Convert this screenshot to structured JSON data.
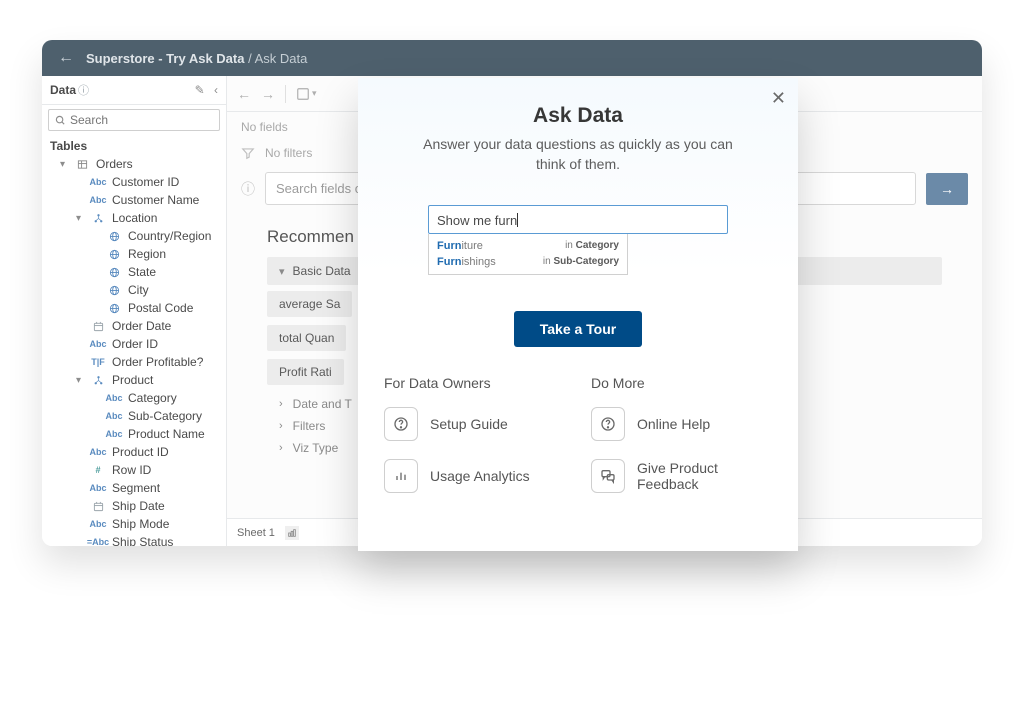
{
  "breadcrumb": {
    "main": "Superstore - Try Ask Data",
    "sub": "Ask Data"
  },
  "sidebar": {
    "title": "Data",
    "search_placeholder": "Search",
    "tables_label": "Tables",
    "tree": [
      {
        "depth": 1,
        "caret": "▾",
        "icon": "table",
        "label": "Orders"
      },
      {
        "depth": 2,
        "icon": "abc",
        "label": "Customer ID"
      },
      {
        "depth": 2,
        "icon": "abc",
        "label": "Customer Name"
      },
      {
        "depth": 2,
        "caret": "▾",
        "icon": "hier",
        "label": "Location"
      },
      {
        "depth": 3,
        "icon": "globe",
        "label": "Country/Region"
      },
      {
        "depth": 3,
        "icon": "globe",
        "label": "Region"
      },
      {
        "depth": 3,
        "icon": "globe",
        "label": "State"
      },
      {
        "depth": 3,
        "icon": "globe",
        "label": "City"
      },
      {
        "depth": 3,
        "icon": "globe",
        "label": "Postal Code"
      },
      {
        "depth": 2,
        "icon": "cal",
        "label": "Order Date"
      },
      {
        "depth": 2,
        "icon": "abc",
        "label": "Order ID"
      },
      {
        "depth": 2,
        "icon": "tf",
        "label": "Order Profitable?"
      },
      {
        "depth": 2,
        "caret": "▾",
        "icon": "hier",
        "label": "Product"
      },
      {
        "depth": 3,
        "icon": "abc",
        "label": "Category"
      },
      {
        "depth": 3,
        "icon": "abc",
        "label": "Sub-Category"
      },
      {
        "depth": 3,
        "icon": "abc",
        "label": "Product Name"
      },
      {
        "depth": 2,
        "icon": "abc",
        "label": "Product ID"
      },
      {
        "depth": 2,
        "icon": "hash",
        "label": "Row ID"
      },
      {
        "depth": 2,
        "icon": "abc",
        "label": "Segment"
      },
      {
        "depth": 2,
        "icon": "cal",
        "label": "Ship Date"
      },
      {
        "depth": 2,
        "icon": "abc",
        "label": "Ship Mode"
      },
      {
        "depth": 2,
        "icon": "calcabc",
        "label": "Ship Status"
      }
    ]
  },
  "main": {
    "no_fields": "No fields",
    "no_filters": "No filters",
    "search_placeholder": "Search fields or va",
    "recommend_title": "Recommen",
    "groups": {
      "basic": {
        "header": "Basic Data",
        "pills": [
          "average Sa",
          "total Quan",
          "Profit Rati"
        ]
      },
      "collapsed": [
        "Date and T",
        "Filters",
        "Viz Type"
      ]
    }
  },
  "footer": {
    "sheet": "Sheet 1"
  },
  "modal": {
    "title": "Ask Data",
    "subtitle": "Answer your data questions as quickly as you can think of them.",
    "input_value": "Show me furn",
    "suggestions": [
      {
        "bold": "Furn",
        "rest": "iture",
        "ctx_pre": "in",
        "ctx_val": "Category"
      },
      {
        "bold": "Furn",
        "rest": "ishings",
        "ctx_pre": "in",
        "ctx_val": "Sub-Category"
      }
    ],
    "tour_btn": "Take a Tour",
    "cols": {
      "owners": {
        "title": "For Data Owners",
        "links": [
          {
            "icon": "help",
            "label": "Setup Guide"
          },
          {
            "icon": "bar",
            "label": "Usage Analytics"
          }
        ]
      },
      "more": {
        "title": "Do More",
        "links": [
          {
            "icon": "help",
            "label": "Online Help"
          },
          {
            "icon": "feedback",
            "label": "Give Product Feedback"
          }
        ]
      }
    }
  }
}
